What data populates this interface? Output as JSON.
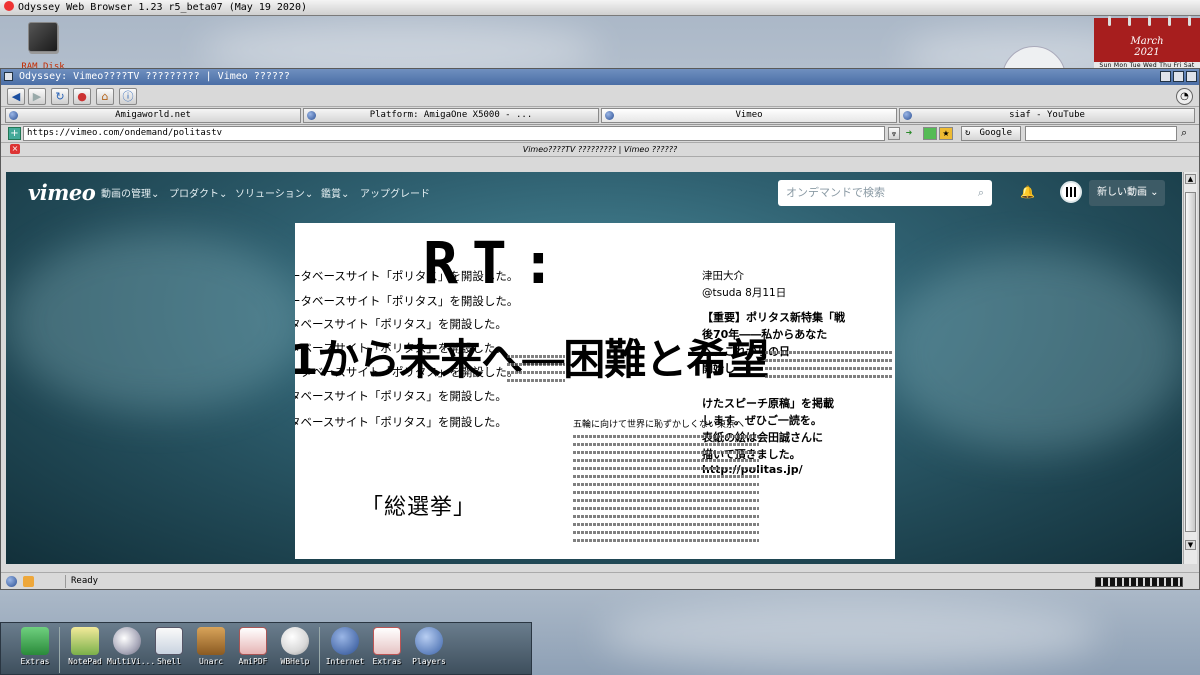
{
  "screen": {
    "title": "Odyssey Web Browser 1.23 r5_beta07 (May 19 2020)"
  },
  "desktop": {
    "ramdisk_label": "RAM Disk"
  },
  "calendar": {
    "month": "March",
    "year": "2021",
    "days": "Sun Mon Tue Wed Thu Fri Sat"
  },
  "window": {
    "title": "Odyssey: Vimeo????TV ????????? | Vimeo ??????"
  },
  "toolbar": {
    "buttons": [
      "back-arrow",
      "forward-arrow",
      "reload",
      "stop",
      "home",
      "info"
    ]
  },
  "tabs": [
    {
      "label": "Amigaworld.net"
    },
    {
      "label": "Platform: AmigaOne X5000 - ..."
    },
    {
      "label": "Vimeo"
    },
    {
      "label": "siaf - YouTube"
    }
  ],
  "addressbar": {
    "url": "https://vimeo.com/ondemand/politastv",
    "search_engine": "Google"
  },
  "page": {
    "title": "Vimeo????TV ????????? | Vimeo ??????"
  },
  "vimeo": {
    "logo": "vimeo",
    "nav": [
      "動画の管理",
      "プロダクト",
      "ソリューション",
      "鑑賞",
      "アップグレード"
    ],
    "search_placeholder": "オンデマンドで検索",
    "new_video": "新しい動画"
  },
  "poster": {
    "repeated_line": "ータベースサイト「ポリタス」を開設した。",
    "repeated_line_b": "タベースサイト「ポリタス」を開設した。",
    "rt": "RT:",
    "headline": "1から未来へ―困難と希望",
    "tweet_author": "津田大介",
    "tweet_handle": "@tsuda  8月11日",
    "tweet_lines": [
      "【重要】ポリタス新特集「戦",
      "後70年――私からあなた",
      "へ、これからの日",
      "開始し",
      "けたスピーチ原稿」を掲載",
      "します。ぜひご一読を。",
      "表紙の絵は会田誠さんに",
      "描いて頂きました。",
      "http://politas.jp/"
    ],
    "essay_title": "五輪に向けて世界に恥ずかしくない東京へ",
    "bottom_label": "「総選挙」"
  },
  "status": {
    "text": "Ready"
  },
  "dock": [
    {
      "label": "Extras"
    },
    {
      "label": "NotePad"
    },
    {
      "label": "MultiVi..."
    },
    {
      "label": "Shell"
    },
    {
      "label": "Unarc"
    },
    {
      "label": "AmiPDF"
    },
    {
      "label": "WBHelp"
    },
    {
      "label": "Internet"
    },
    {
      "label": "Extras"
    },
    {
      "label": "Players"
    }
  ],
  "colors": {
    "title_accent": "#4a6ea6",
    "calendar_red": "#a71e1e",
    "vimeo_bg": "#2f6070"
  }
}
